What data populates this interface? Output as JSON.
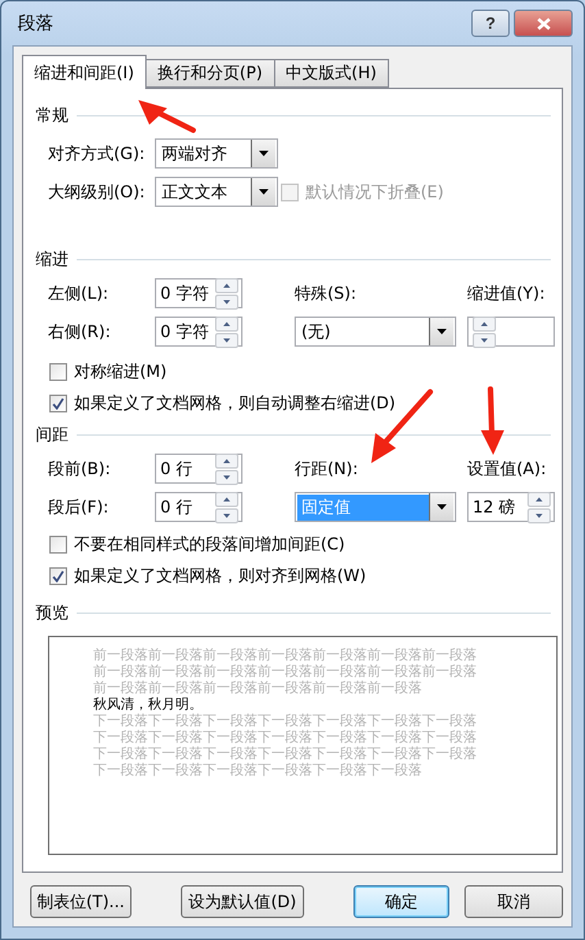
{
  "window": {
    "title": "段落",
    "help": "?"
  },
  "tabs": [
    {
      "label": "缩进和间距(I)",
      "selected": true
    },
    {
      "label": "换行和分页(P)",
      "selected": false
    },
    {
      "label": "中文版式(H)",
      "selected": false
    }
  ],
  "general": {
    "heading": "常规",
    "alignment": {
      "label": "对齐方式(G):",
      "value": "两端对齐"
    },
    "outline_level": {
      "label": "大纲级别(O):",
      "value": "正文文本"
    },
    "collapse": {
      "label": "默认情况下折叠(E)",
      "checked": false,
      "disabled": true
    }
  },
  "indentation": {
    "heading": "缩进",
    "left": {
      "label": "左侧(L):",
      "value": "0 字符"
    },
    "right": {
      "label": "右侧(R):",
      "value": "0 字符"
    },
    "special": {
      "label": "特殊(S):",
      "value": "(无)"
    },
    "by": {
      "label": "缩进值(Y):"
    },
    "options": [
      {
        "label": "对称缩进(M)",
        "checked": false
      },
      {
        "label": "如果定义了文档网格，则自动调整右缩进(D)",
        "checked": true
      }
    ]
  },
  "spacing": {
    "heading": "间距",
    "before": {
      "label": "段前(B):",
      "value": "0 行"
    },
    "after": {
      "label": "段后(F):",
      "value": "0 行"
    },
    "line_spacing": {
      "label": "行距(N):",
      "value": "固定值",
      "highlighted": true
    },
    "at": {
      "label": "设置值(A):",
      "value": "12 磅"
    },
    "options": [
      {
        "label": "不要在相同样式的段落间增加间距(C)",
        "checked": false
      },
      {
        "label": "如果定义了文档网格，则对齐到网格(W)",
        "checked": true
      }
    ]
  },
  "preview": {
    "heading": "预览",
    "previous": "前一段落前一段落前一段落前一段落前一段落前一段落前一段落前一段落前一段落前一段落前一段落前一段落前一段落前一段落前一段落前一段落前一段落前一段落前一段落前一段落",
    "sample": "秋风清，秋月明。",
    "following": "下一段落下一段落下一段落下一段落下一段落下一段落下一段落下一段落下一段落下一段落下一段落下一段落下一段落下一段落下一段落下一段落下一段落下一段落下一段落下一段落下一段落下一段落下一段落下一段落下一段落下一段落下一段落"
  },
  "buttons": [
    {
      "label": "制表位(T)...",
      "default": false
    },
    {
      "label": "设为默认值(D)",
      "default": false
    },
    {
      "label": "确定",
      "default": true
    },
    {
      "label": "取消",
      "default": false
    }
  ]
}
